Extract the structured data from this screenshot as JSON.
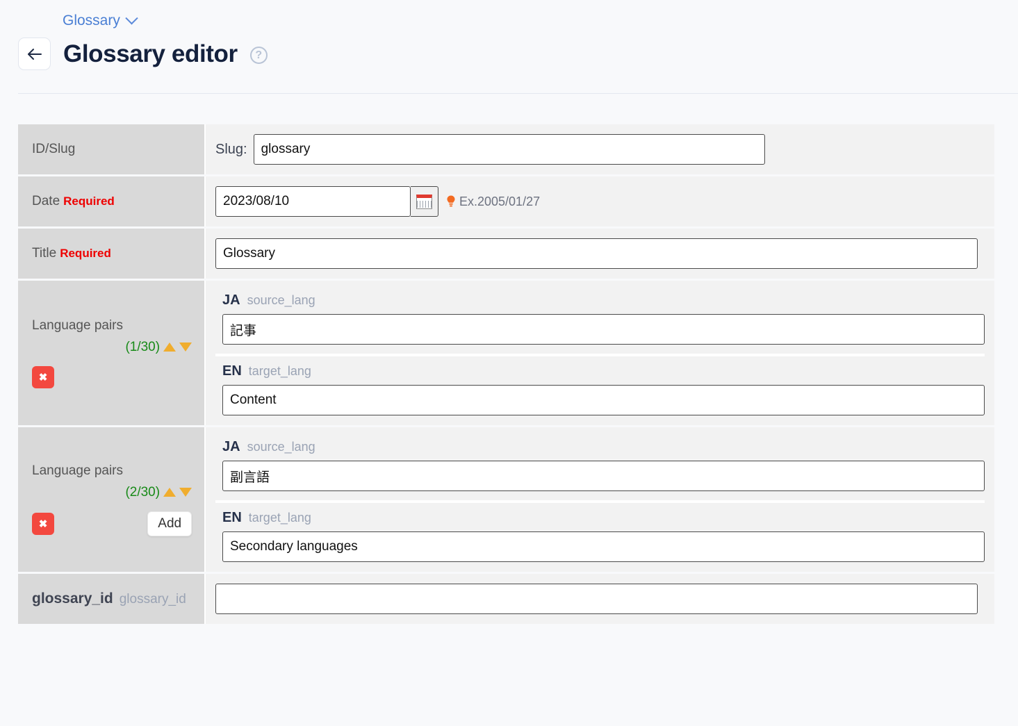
{
  "header": {
    "breadcrumb_label": "Glossary",
    "breadcrumb_icon": "chevron-down-icon",
    "back_icon": "arrow-left-icon",
    "title": "Glossary editor",
    "help_icon": "question-circle-icon",
    "help_glyph": "?"
  },
  "form": {
    "id_slug": {
      "label": "ID/Slug",
      "prefix": "Slug:",
      "value": "glossary",
      "placeholder": ""
    },
    "date": {
      "label": "Date",
      "required_label": "Required",
      "value": "2023/08/10",
      "placeholder": "",
      "calendar_icon": "calendar-icon",
      "hint_icon": "lightbulb-icon",
      "hint": "Ex.2005/01/27"
    },
    "title": {
      "label": "Title",
      "required_label": "Required",
      "value": "Glossary",
      "placeholder": ""
    },
    "language_pairs": [
      {
        "label": "Language pairs",
        "count": "(1/30)",
        "move_up_icon": "triangle-up-icon",
        "move_down_icon": "triangle-down-icon",
        "delete_icon": "close-x-icon",
        "delete_glyph": "✖",
        "add_label": "",
        "source": {
          "code": "JA",
          "key": "source_lang",
          "value": "記事",
          "placeholder": ""
        },
        "target": {
          "code": "EN",
          "key": "target_lang",
          "value": "Content",
          "placeholder": ""
        }
      },
      {
        "label": "Language pairs",
        "count": "(2/30)",
        "move_up_icon": "triangle-up-icon",
        "move_down_icon": "triangle-down-icon",
        "delete_icon": "close-x-icon",
        "delete_glyph": "✖",
        "add_label": "Add",
        "source": {
          "code": "JA",
          "key": "source_lang",
          "value": "副言語",
          "placeholder": ""
        },
        "target": {
          "code": "EN",
          "key": "target_lang",
          "value": "Secondary languages",
          "placeholder": ""
        }
      }
    ],
    "glossary_id": {
      "label": "glossary_id",
      "sub_label": "glossary_id",
      "value": "",
      "placeholder": ""
    }
  },
  "colors": {
    "page_bg": "#f8f9fb",
    "label_cell_bg": "#d9d9d9",
    "value_cell_bg": "#f2f2f2",
    "link": "#4a7fd4",
    "title": "#14213d",
    "required_red": "#ee0000",
    "count_green": "#188a18",
    "triangle_orange": "#f0ad2e",
    "delete_red": "#f3483f",
    "lang_code": "#26314a",
    "lang_key": "#9aa3b4"
  }
}
